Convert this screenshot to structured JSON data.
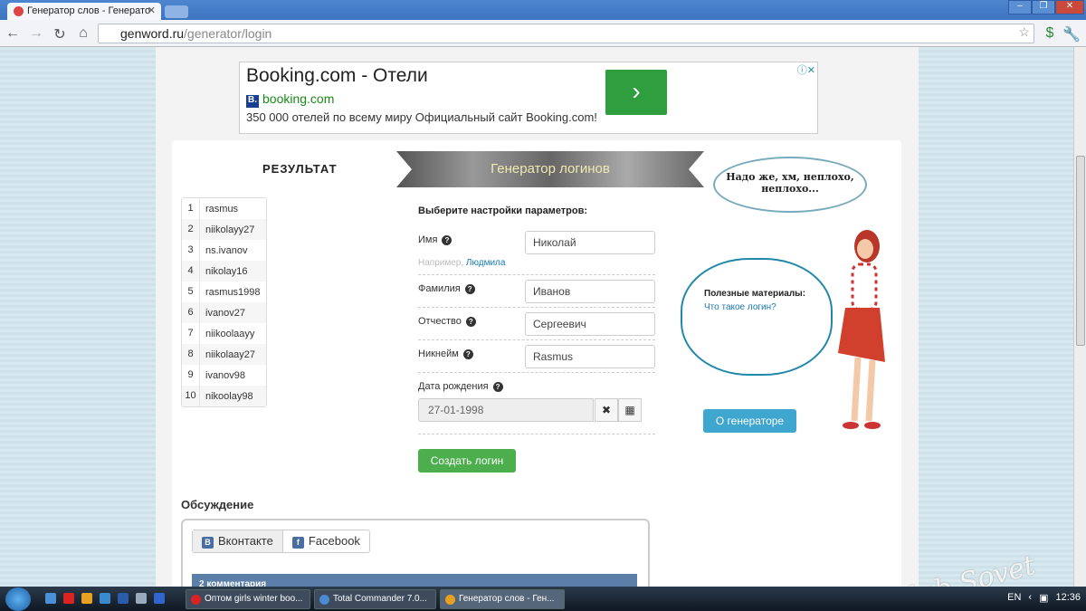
{
  "browser": {
    "tab_title": "Генератор слов - Генерато",
    "url_domain": "genword.ru",
    "url_path": "/generator/login"
  },
  "ad": {
    "title": "Booking.com - Отели",
    "url": "booking.com",
    "description": "350 000 отелей по всему миру Официальный сайт Booking.com!"
  },
  "result": {
    "title": "РЕЗУЛЬТАТ",
    "items": [
      "rasmus",
      "niikolayy27",
      "ns.ivanov",
      "nikolay16",
      "rasmus1998",
      "ivanov27",
      "niikoolaayy",
      "niikolaay27",
      "ivanov98",
      "nikoolay98"
    ]
  },
  "generator": {
    "banner": "Генератор логинов",
    "heading": "Выберите настройки параметров:",
    "name_label": "Имя",
    "name_value": "Николай",
    "hint_prefix": "Например,",
    "hint_link": "Людмила",
    "surname_label": "Фамилия",
    "surname_value": "Иванов",
    "patronymic_label": "Отчество",
    "patronymic_value": "Сергеевич",
    "nickname_label": "Никнейм",
    "nickname_value": "Rasmus",
    "birth_label": "Дата рождения",
    "birth_value": "27-01-1998",
    "create_button": "Создать логин"
  },
  "sidebar": {
    "speech": "Надо же, хм, неплохо, неплохо...",
    "materials_title": "Полезные материалы:",
    "materials_link": "Что такое логин?",
    "about_button": "О генераторе"
  },
  "discussion": {
    "title": "Обсуждение",
    "tabs": [
      "Вконтакте",
      "Facebook"
    ],
    "comments_count": "2 комментария"
  },
  "taskbar": {
    "tasks": [
      "Оптом girls winter boo...",
      "Total Commander 7.0...",
      "Генератор слов - Ген..."
    ],
    "lang": "EN",
    "time": "12:36"
  },
  "watermark": "club Sovet"
}
